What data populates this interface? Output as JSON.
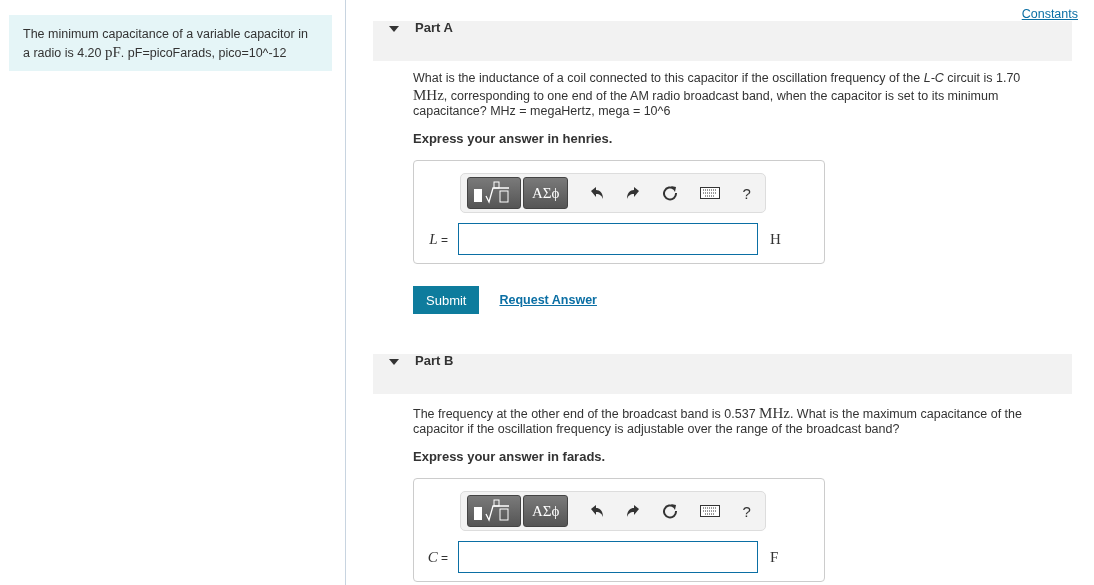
{
  "intro": [
    {
      "kind": "text",
      "text": "The minimum capacitance of a variable capacitor in a radio is 4.20 "
    },
    {
      "kind": "math",
      "text": "pF"
    },
    {
      "kind": "text",
      "text": ". pF=picoFarads, pico=10^-12"
    }
  ],
  "constants_link": "Constants",
  "parts": [
    {
      "title": "Part A",
      "expanded": true,
      "question": [
        {
          "kind": "text",
          "text": "What is the inductance of a coil connected to this capacitor if the oscillation frequency of the "
        },
        {
          "kind": "italic",
          "text": "L-C"
        },
        {
          "kind": "text",
          "text": " circuit is 1.70 "
        },
        {
          "kind": "math",
          "text": "MHz"
        },
        {
          "kind": "text",
          "text": ", corresponding to one end of the AM radio broadcast band, when the capacitor is set to its minimum capacitance? MHz = megaHertz, mega = 10^6"
        }
      ],
      "instruction": "Express your answer in henries.",
      "toolbar": {
        "symbols": "ΑΣϕ",
        "help": "?"
      },
      "variable": "L",
      "equals": "=",
      "unit": "H",
      "buttons": {
        "submit": "Submit",
        "request": "Request Answer"
      }
    },
    {
      "title": "Part B",
      "expanded": true,
      "question": [
        {
          "kind": "text",
          "text": "The frequency at the other end of the broadcast band is 0.537 "
        },
        {
          "kind": "math",
          "text": "MHz"
        },
        {
          "kind": "text",
          "text": ". What is the maximum capacitance of the capacitor if the oscillation frequency is adjustable over the range of the broadcast band?"
        }
      ],
      "instruction": "Express your answer in farads.",
      "toolbar": {
        "symbols": "ΑΣϕ",
        "help": "?"
      },
      "variable": "C",
      "equals": "=",
      "unit": "F"
    }
  ]
}
